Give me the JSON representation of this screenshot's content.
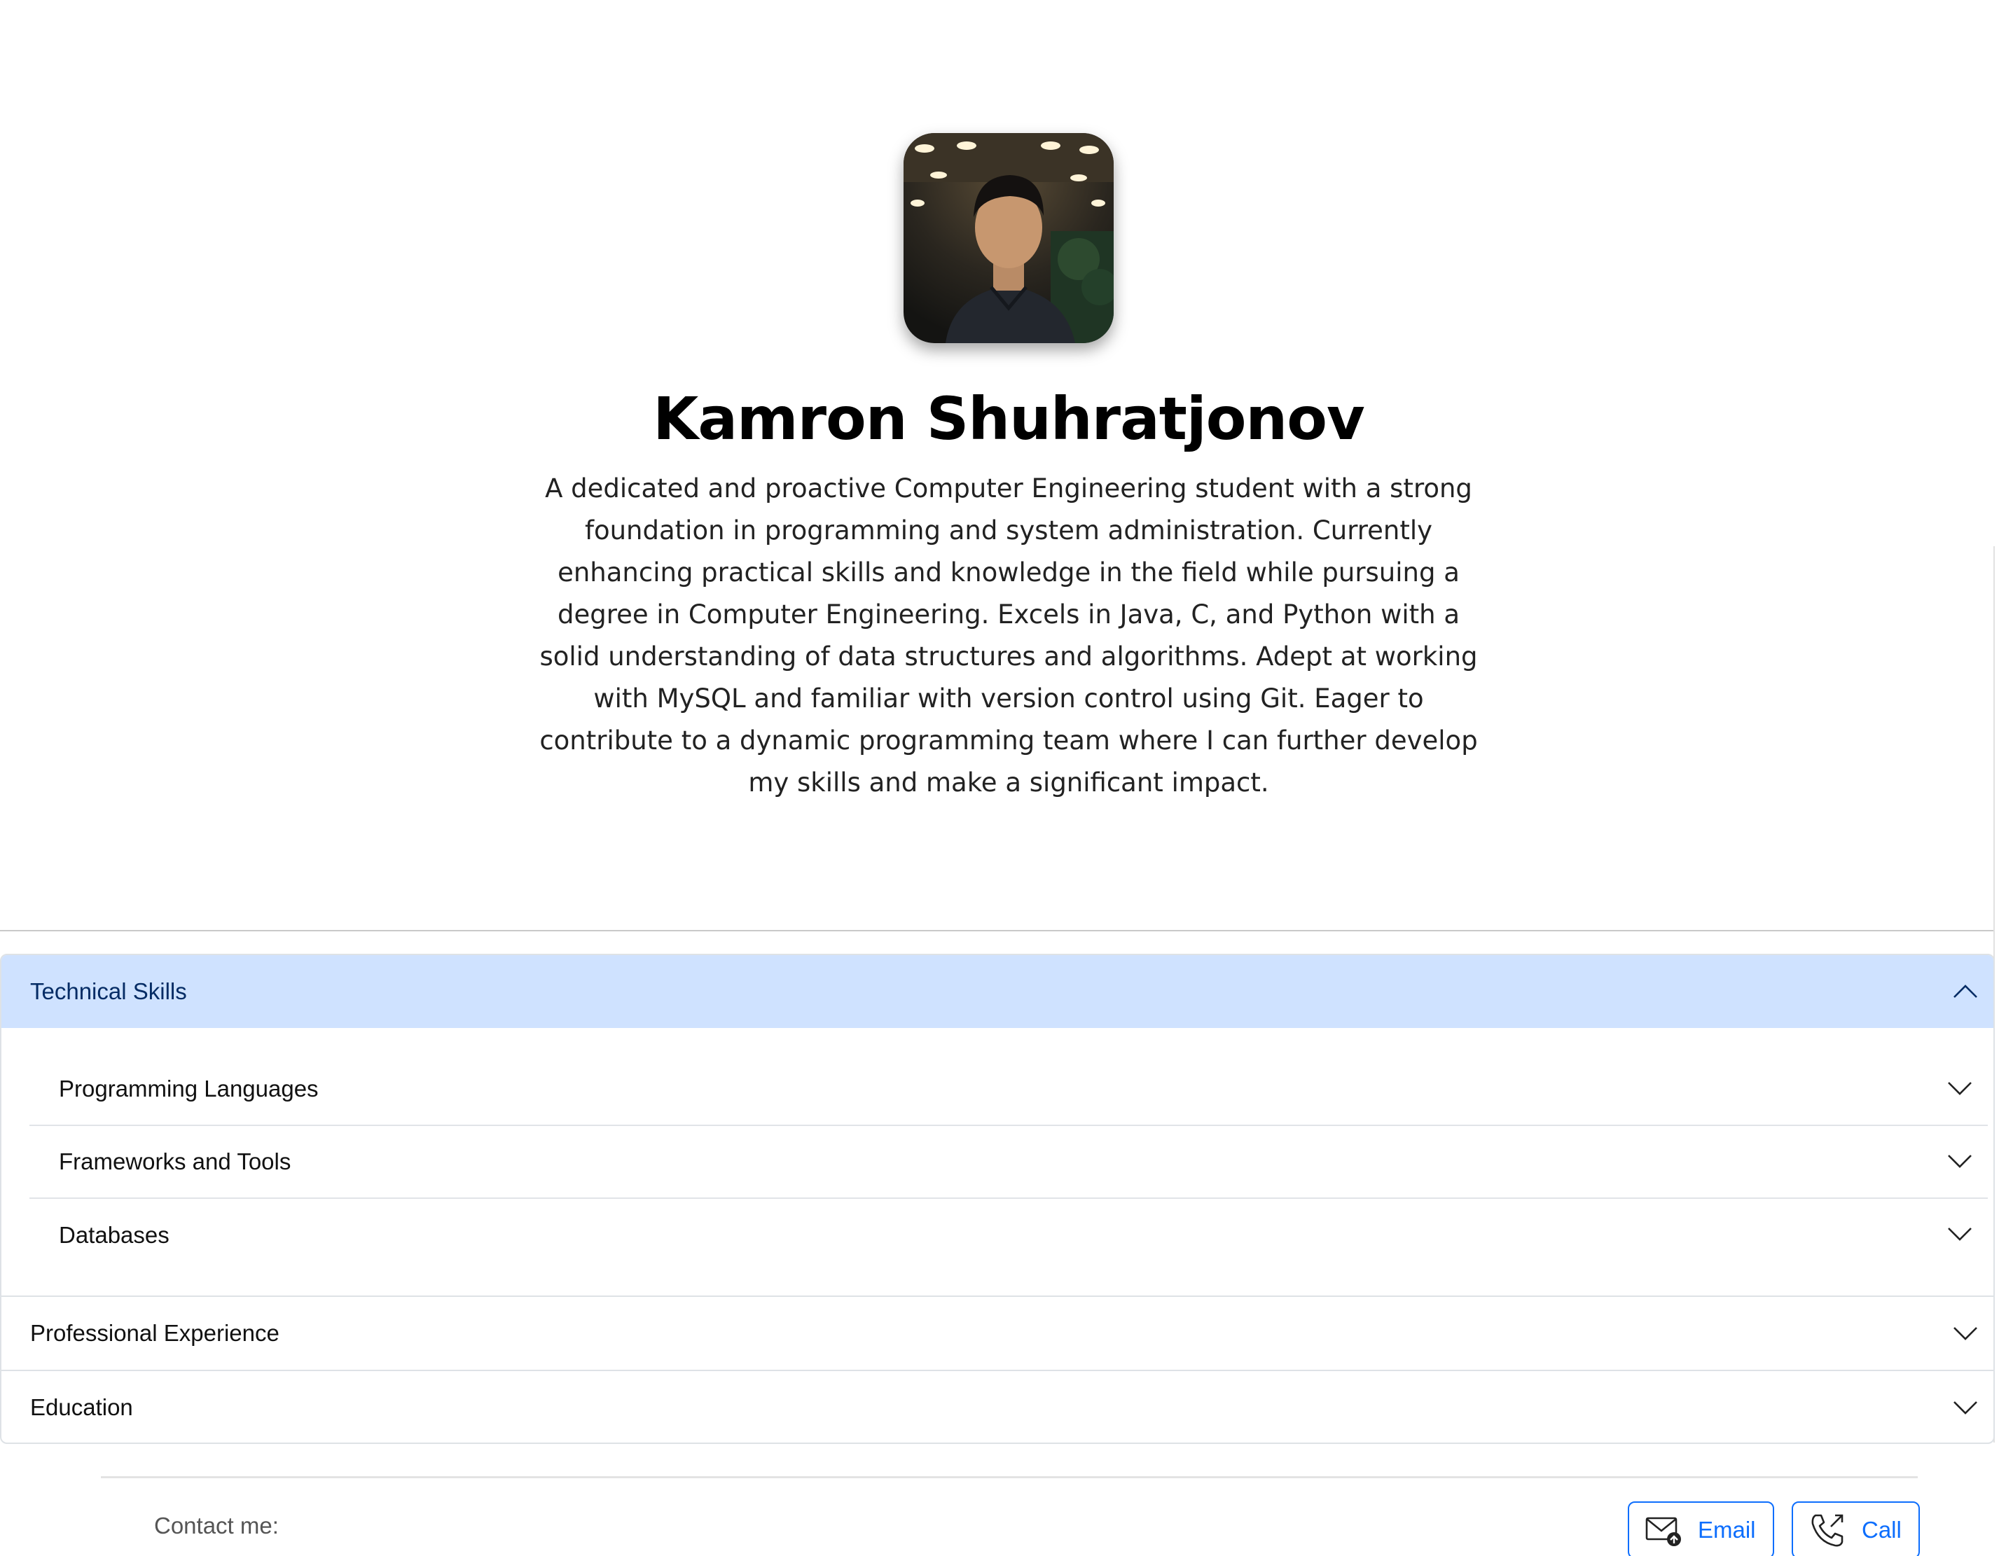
{
  "profile": {
    "name": "Kamron Shuhratjonov",
    "summary": "A dedicated and proactive Computer Engineering student with a strong foundation in programming and system administration. Currently enhancing practical skills and knowledge in the field while pursuing a degree in Computer Engineering. Excels in Java, C, and Python with a solid understanding of data structures and algorithms. Adept at working with MySQL and familiar with version control using Git. Eager to contribute to a dynamic programming team where I can further develop my skills and make a significant impact.",
    "avatar_icon": "profile-photo"
  },
  "accordion": {
    "technical_skills": {
      "label": "Technical Skills",
      "expanded": true,
      "items": [
        {
          "label": "Programming Languages"
        },
        {
          "label": "Frameworks and Tools"
        },
        {
          "label": "Databases"
        }
      ]
    },
    "professional_experience": {
      "label": "Professional Experience"
    },
    "education": {
      "label": "Education"
    }
  },
  "contact": {
    "label": "Contact me:",
    "email_label": "Email",
    "call_label": "Call",
    "email_icon": "envelope-icon",
    "call_icon": "phone-outgoing-icon"
  },
  "colors": {
    "accent": "#0d6efd",
    "active_header_bg": "#cfe2ff",
    "active_header_text": "#052c65"
  }
}
